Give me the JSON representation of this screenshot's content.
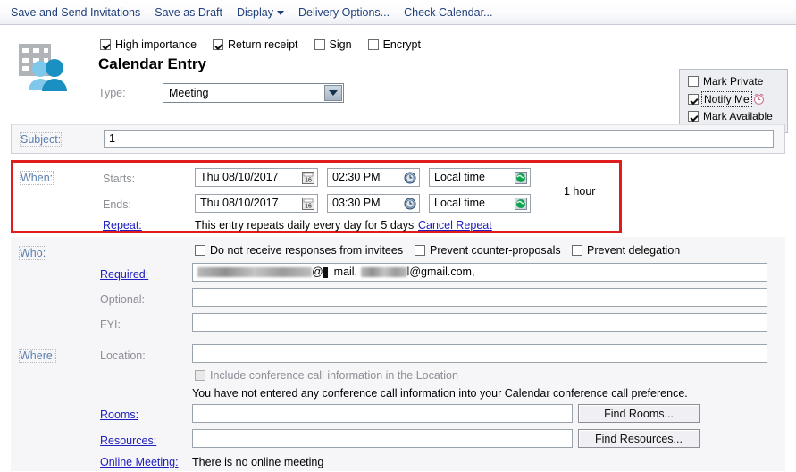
{
  "toolbar": {
    "items": [
      {
        "label": "Save and Send Invitations",
        "caret": false
      },
      {
        "label": "Save as Draft",
        "caret": false
      },
      {
        "label": "Display",
        "caret": true
      },
      {
        "label": "Delivery Options...",
        "caret": false
      },
      {
        "label": "Check Calendar...",
        "caret": false
      }
    ]
  },
  "header": {
    "icon_name": "calendar-people-icon",
    "title": "Calendar Entry",
    "options": [
      {
        "label": "High importance",
        "checked": true
      },
      {
        "label": "Return receipt",
        "checked": true
      },
      {
        "label": "Sign",
        "checked": false
      },
      {
        "label": "Encrypt",
        "checked": false
      }
    ],
    "type": {
      "label": "Type:",
      "value": "Meeting"
    },
    "right_options": [
      {
        "label": "Mark Private",
        "checked": false,
        "focused": false,
        "icon": ""
      },
      {
        "label": "Notify Me",
        "checked": true,
        "focused": true,
        "icon": "alarm-clock-icon"
      },
      {
        "label": "Mark Available",
        "checked": true,
        "focused": false,
        "icon": ""
      }
    ]
  },
  "subject": {
    "label": "Subject:",
    "value": "1"
  },
  "when": {
    "section_label": "When:",
    "starts_label": "Starts:",
    "ends_label": "Ends:",
    "repeat_label": "Repeat:",
    "starts_date": "Thu 08/10/2017",
    "starts_time": "02:30 PM",
    "starts_zone": "Local time",
    "ends_date": "Thu 08/10/2017",
    "ends_time": "03:30 PM",
    "ends_zone": "Local time",
    "duration": "1 hour",
    "repeat_text": "This entry repeats daily every day for 5 days",
    "cancel_repeat": "Cancel Repeat"
  },
  "who": {
    "section_label": "Who:",
    "checkboxes": [
      {
        "label": "Do not receive responses from invitees",
        "checked": false
      },
      {
        "label": "Prevent counter-proposals",
        "checked": false
      },
      {
        "label": "Prevent delegation",
        "checked": false
      }
    ],
    "required_label": "Required:",
    "required_value_visible": "@",
    "required_value_tail": "mail,",
    "required_value_tail2": "l@gmail.com,",
    "optional_label": "Optional:",
    "optional_value": "",
    "fyi_label": "FYI:",
    "fyi_value": ""
  },
  "where": {
    "section_label": "Where:",
    "location_label": "Location:",
    "location_value": "",
    "conf_checkbox_label": "Include conference call information in the Location",
    "conf_checkbox_checked": false,
    "conf_note": "You have not entered any conference call information into your Calendar conference call preference.",
    "rooms_label": "Rooms:",
    "rooms_value": "",
    "find_rooms_button": "Find Rooms...",
    "resources_label": "Resources:",
    "resources_value": "",
    "find_resources_button": "Find Resources...",
    "online_meeting_label": "Online Meeting:",
    "online_meeting_text": "There is no online meeting"
  },
  "colors": {
    "highlight_red": "#e01b1b",
    "link_blue": "#2020c0",
    "section_label_blue": "#5a7fae",
    "toolbar_text": "#1f3f7a"
  }
}
